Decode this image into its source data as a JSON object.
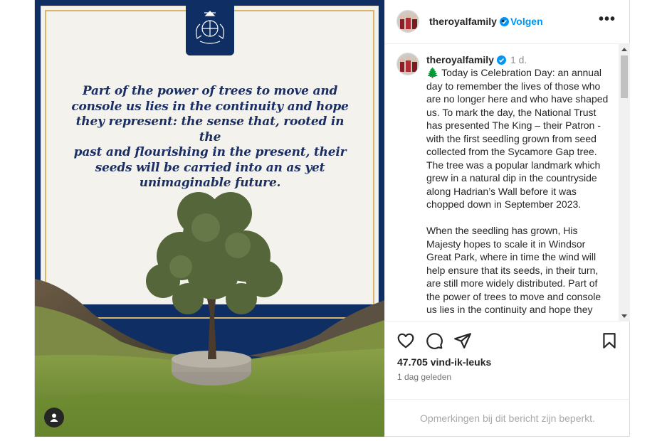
{
  "post": {
    "quote_lines": [
      "Part of the power of trees to move and",
      "console us lies in the continuity and hope",
      "they represent: the sense that, rooted in the",
      "past and flourishing in the present, their",
      "seeds will be carried into an as yet",
      "unimaginable future."
    ],
    "colors": {
      "navy": "#0f2e63",
      "gold": "#d9b56b",
      "link": "#0095f6"
    }
  },
  "header": {
    "username": "theroyalfamily",
    "separator": "•",
    "follow_label": "Volgen",
    "more_label": "•••"
  },
  "caption": {
    "username": "theroyalfamily",
    "time": "1 d.",
    "text": "🌲 Today is Celebration Day: an annual day to remember the lives of those who are no longer here and who have shaped us. To mark the day, the National Trust has presented The King – their Patron - with the first seedling grown from seed collected from the Sycamore Gap tree. The tree was a popular landmark which grew in a natural dip in the countryside along Hadrian’s Wall before it was chopped down in September 2023.\n\nWhen the seedling has grown, His Majesty hopes to scale it in Windsor Great Park, where in time the wind will help ensure that its seeds, in their turn, are still more widely distributed. Part of the power of trees to move and console us lies in the continuity and hope they"
  },
  "stats": {
    "likes": "47.705 vind-ik-leuks",
    "posted_ago": "1 dag geleden"
  },
  "footer": {
    "comments_restricted": "Opmerkingen bij dit bericht zijn beperkt."
  },
  "icons": [
    "heart-icon",
    "comment-icon",
    "share-icon",
    "bookmark-icon",
    "verified-icon",
    "user-tag-icon",
    "royal-crest-icon"
  ]
}
